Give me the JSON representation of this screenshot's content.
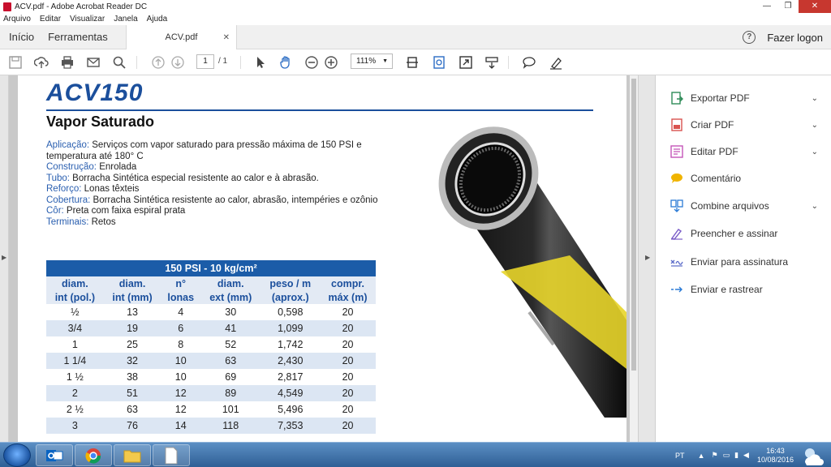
{
  "window": {
    "title": "ACV.pdf - Adobe Acrobat Reader DC",
    "minimize": "—",
    "restore": "❐",
    "close": "✕"
  },
  "menu": [
    "Arquivo",
    "Editar",
    "Visualizar",
    "Janela",
    "Ajuda"
  ],
  "tabs": {
    "home": "Início",
    "tools": "Ferramentas",
    "document": "ACV.pdf",
    "close": "✕",
    "login": "Fazer logon",
    "help": "?"
  },
  "toolbar": {
    "page_current": "1",
    "page_total": "/ 1",
    "zoom": "111%",
    "zoom_caret": "▼"
  },
  "document": {
    "title": "ACV150",
    "subtitle": "Vapor Saturado",
    "specs": [
      {
        "key": "Aplicação:",
        "value": " Serviços com vapor saturado para pressão máxima de 150 PSI e temperatura até 180° C"
      },
      {
        "key": "Construção:",
        "value": " Enrolada"
      },
      {
        "key": "Tubo:",
        "value": " Borracha Sintética especial resistente ao calor e à abrasão."
      },
      {
        "key": "Reforço:",
        "value": " Lonas têxteis"
      },
      {
        "key": "Cobertura:",
        "value": " Borracha Sintética resistente ao calor, abrasão, intempéries e ozônio"
      },
      {
        "key": "Côr:",
        "value": " Preta com faixa espiral prata"
      },
      {
        "key": "Terminais:",
        "value": " Retos"
      }
    ],
    "table": {
      "banner": "150 PSI - 10 kg/cm²",
      "headers_top": [
        "diam.",
        "diam.",
        "n°",
        "diam.",
        "peso / m",
        "compr."
      ],
      "headers_bottom": [
        "int (pol.)",
        "int (mm)",
        "lonas",
        "ext (mm)",
        "(aprox.)",
        "máx (m)"
      ],
      "rows": [
        [
          "½",
          "13",
          "4",
          "30",
          "0,598",
          "20"
        ],
        [
          "3/4",
          "19",
          "6",
          "41",
          "1,099",
          "20"
        ],
        [
          "1",
          "25",
          "8",
          "52",
          "1,742",
          "20"
        ],
        [
          "1 1/4",
          "32",
          "10",
          "63",
          "2,430",
          "20"
        ],
        [
          "1 ½",
          "38",
          "10",
          "69",
          "2,817",
          "20"
        ],
        [
          "2",
          "51",
          "12",
          "89",
          "4,549",
          "20"
        ],
        [
          "2 ½",
          "63",
          "12",
          "101",
          "5,496",
          "20"
        ],
        [
          "3",
          "76",
          "14",
          "118",
          "7,353",
          "20"
        ]
      ]
    }
  },
  "panel": {
    "items": [
      {
        "label": "Exportar PDF",
        "icon": "export-pdf-icon",
        "color": "#2e8b57",
        "chevron": "⌄"
      },
      {
        "label": "Criar PDF",
        "icon": "create-pdf-icon",
        "color": "#d9534f",
        "chevron": "⌄"
      },
      {
        "label": "Editar PDF",
        "icon": "edit-pdf-icon",
        "color": "#c455b8",
        "chevron": "⌄"
      },
      {
        "label": "Comentário",
        "icon": "comment-icon",
        "color": "#f0b400"
      },
      {
        "label": "Combine arquivos",
        "icon": "combine-files-icon",
        "color": "#2b7bd6",
        "chevron": "⌄"
      },
      {
        "label": "Preencher e assinar",
        "icon": "fill-sign-icon",
        "color": "#7a5cc8"
      },
      {
        "label": "Enviar para assinatura",
        "icon": "send-signature-icon",
        "color": "#5a6bc8"
      },
      {
        "label": "Enviar e rastrear",
        "icon": "send-track-icon",
        "color": "#2b7bd6"
      }
    ]
  },
  "taskbar": {
    "lang": "PT",
    "time": "16:43",
    "date": "10/08/2016"
  }
}
